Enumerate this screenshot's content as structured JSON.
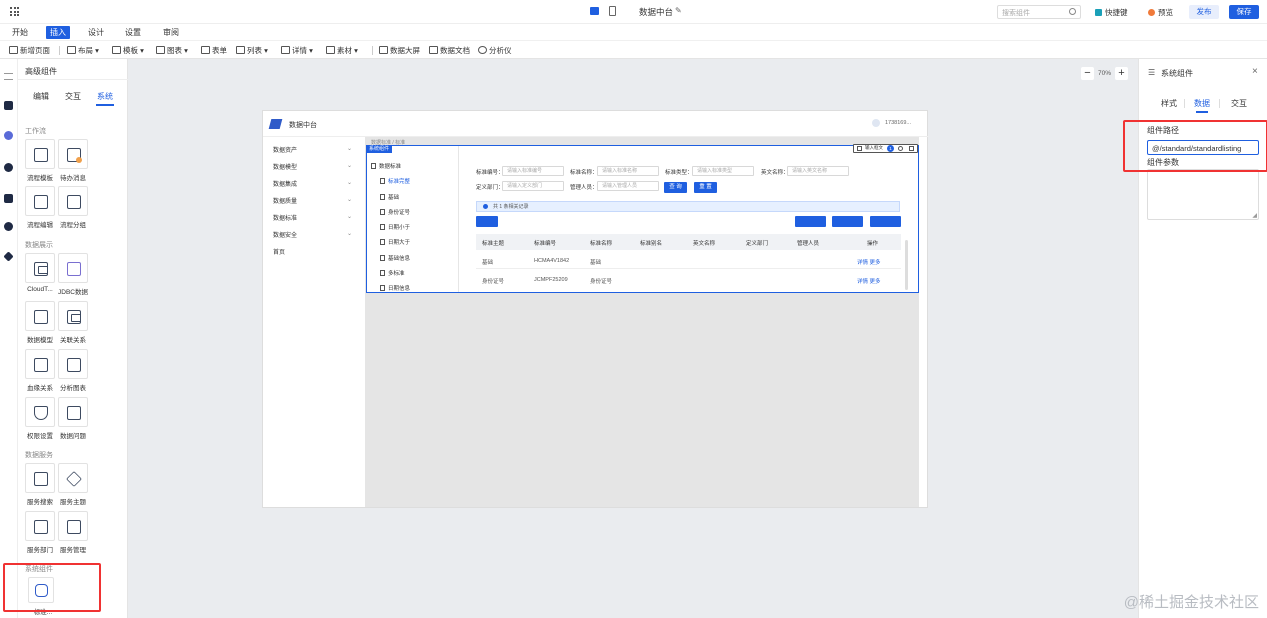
{
  "topbar": {
    "app_title": "数据中台",
    "search_placeholder": "搜索组件",
    "shortcut_label": "快捷键",
    "preview_label": "预览",
    "publish_label": "发布",
    "save_label": "保存"
  },
  "menu": {
    "tabs": [
      "开始",
      "插入",
      "设计",
      "设置",
      "审阅"
    ],
    "active": "插入"
  },
  "toolbar": {
    "items": [
      "新增页面",
      "布局",
      "模板",
      "图表",
      "表单",
      "列表",
      "详情",
      "素材",
      "数据大屏",
      "数据文档",
      "分析仪"
    ]
  },
  "left_panel": {
    "title": "高级组件",
    "tabs": [
      "编辑",
      "交互",
      "系统"
    ],
    "active_tab": "系统",
    "sections": [
      {
        "name": "工作流",
        "items": [
          "流程模板",
          "待办消息",
          "流程编辑",
          "流程分组"
        ]
      },
      {
        "name": "数据展示",
        "items": [
          "CloudT...",
          "JDBC数据",
          "数据模型",
          "关联关系",
          "血缘关系",
          "分析图表",
          "权限设置",
          "数据问题"
        ]
      },
      {
        "name": "数据服务",
        "items": [
          "服务搜索",
          "服务主题",
          "服务部门",
          "服务管理"
        ]
      },
      {
        "name": "系统组件",
        "items": [
          "标准..."
        ]
      }
    ]
  },
  "zoom": {
    "value": "70%",
    "minus": "−",
    "plus": "+"
  },
  "preview_page": {
    "header_title": "数据中台",
    "user": "1738169...",
    "nav": [
      "数据资产",
      "数据模型",
      "数据集成",
      "数据质量",
      "数据标准",
      "数据安全",
      "首页"
    ],
    "breadcrumb": "数据标准 / 标准",
    "component_tag": "系统组件",
    "comp_toolbar_label": "输入框文",
    "comp_toolbar_badge": "1",
    "tree": [
      "数据标准",
      "标准完整",
      "基础",
      "身份证号",
      "日期小于",
      "日期大于",
      "基础信息",
      "多标准",
      "日期信息"
    ],
    "form": {
      "labels": [
        "标准编号：",
        "标准名称：",
        "标准类型：",
        "英文名称：",
        "定义部门：",
        "管理人员："
      ],
      "placeholders": [
        "请输入标准编号",
        "请输入标准名称",
        "请输入标准类型",
        "请输入英文名称",
        "请输入定义部门",
        "请输入管理人员"
      ],
      "search": "查 询",
      "reset": "重 置"
    },
    "alert": "共 1 条相关记录",
    "table": {
      "headers": [
        "标准主题",
        "标准编号",
        "标准名称",
        "标准别名",
        "英文名称",
        "定义部门",
        "管理人员",
        "操作"
      ],
      "rows": [
        {
          "theme": "基础",
          "code": "HCMA4V1842",
          "name": "基础",
          "actions": "详情  更多"
        },
        {
          "theme": "身份证号",
          "code": "JCMPF25209",
          "name": "身份证号",
          "actions": "详情  更多"
        }
      ]
    }
  },
  "right_panel": {
    "title": "系统组件",
    "tabs": [
      "样式",
      "数据",
      "交互"
    ],
    "active_tab": "数据",
    "path_label": "组件路径",
    "path_value": "@/standard/standardlisting",
    "params_label": "组件参数",
    "close": "×"
  },
  "watermark": "@稀土掘金技术社区",
  "colors": {
    "accent": "#1f5fe0",
    "highlight": "#f03232"
  }
}
